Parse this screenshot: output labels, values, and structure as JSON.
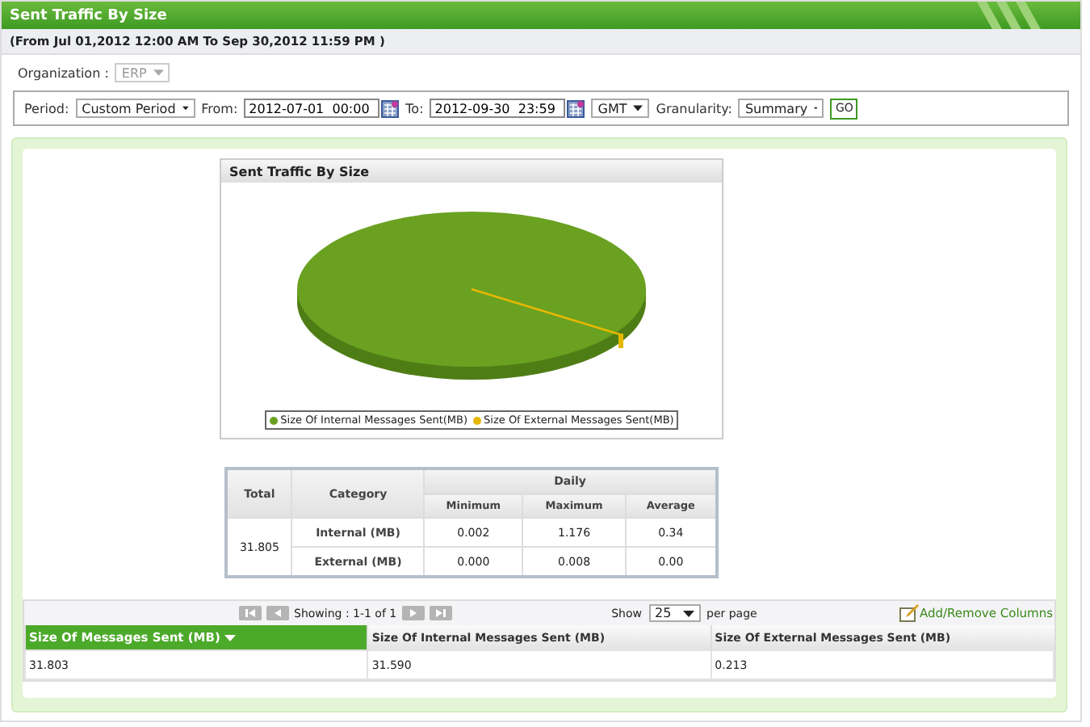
{
  "window": {
    "title": "Sent Traffic By Size",
    "subtitle": "(From Jul 01,2012 12:00 AM To Sep 30,2012 11:59 PM )"
  },
  "organization": {
    "label": "Organization :",
    "value": "ERP",
    "disabled": true
  },
  "filters": {
    "period_label": "Period:",
    "period": "Custom Period",
    "from_label": "From:",
    "from": "2012-07-01  00:00",
    "to_label": "To:",
    "to": "2012-09-30  23:59",
    "timezone": "GMT",
    "granularity_label": "Granularity:",
    "granularity": "Summary",
    "go": "GO"
  },
  "chart": {
    "title": "Sent Traffic By Size",
    "legend": [
      {
        "label": "Size Of Internal Messages Sent(MB)",
        "color": "#6aa121"
      },
      {
        "label": "Size Of External Messages Sent(MB)",
        "color": "#e6b800"
      }
    ]
  },
  "summary": {
    "headers": {
      "total": "Total",
      "category": "Category",
      "group": "Daily",
      "min": "Minimum",
      "max": "Maximum",
      "avg": "Average"
    },
    "total": "31.805",
    "rows": [
      {
        "category": "Internal (MB)",
        "min": "0.002",
        "max": "1.176",
        "avg": "0.34"
      },
      {
        "category": "External (MB)",
        "min": "0.000",
        "max": "0.008",
        "avg": "0.00"
      }
    ]
  },
  "grid": {
    "showing": "Showing :  1-1 of 1",
    "show_label": "Show",
    "page_size": "25",
    "per_page": "per page",
    "columns_link": "Add/Remove Columns",
    "columns": [
      {
        "label": "Size Of Messages Sent (MB)",
        "selected": true
      },
      {
        "label": "Size Of Internal Messages Sent (MB)",
        "selected": false
      },
      {
        "label": "Size Of External Messages Sent (MB)",
        "selected": false
      }
    ],
    "rows": [
      [
        "31.803",
        "31.590",
        "0.213"
      ]
    ]
  }
}
